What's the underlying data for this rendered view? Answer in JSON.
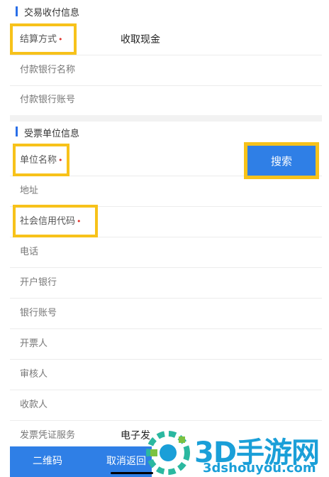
{
  "transaction_section": {
    "title": "交易收付信息",
    "settlement_label": "结算方式",
    "settlement_value": "收取现金",
    "payer_bank_label": "付款银行名称",
    "payer_account_label": "付款银行账号"
  },
  "receiver_section": {
    "title": "受票单位信息",
    "unit_name_label": "单位名称",
    "search_label": "搜索",
    "address_label": "地址",
    "credit_code_label": "社会信用代码",
    "phone_label": "电话",
    "bank_label": "开户银行",
    "bank_account_label": "银行账号",
    "issuer_label": "开票人",
    "reviewer_label": "审核人",
    "payee_label": "收款人",
    "invoice_service_label": "发票凭证服务",
    "invoice_service_value": "电子发"
  },
  "bottom_bar": {
    "qrcode_label": "二维码",
    "cancel_label": "取消返回"
  },
  "watermark": {
    "logo": "3D手游网",
    "url": "3dshouyou.com"
  },
  "colors": {
    "accent": "#2f7fe6",
    "highlight": "#f7c21a",
    "required": "#e0322b"
  }
}
